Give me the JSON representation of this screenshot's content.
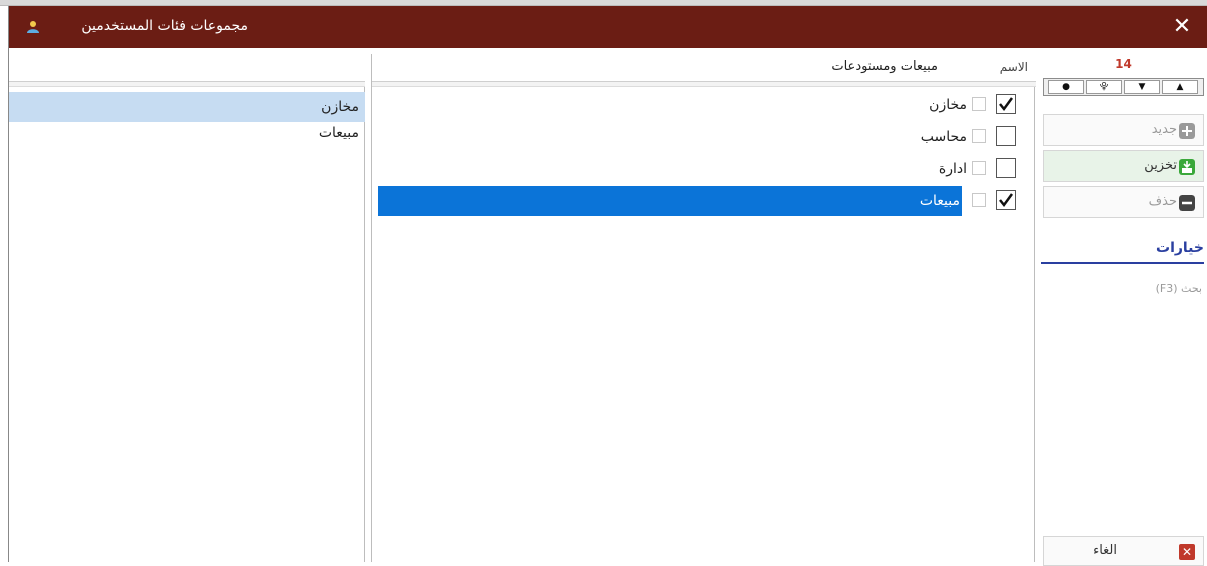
{
  "window": {
    "title": "مجموعات فئات المستخدمين",
    "close_glyph": "✕"
  },
  "left_list": {
    "items": [
      {
        "label": "مخازن",
        "selected": true
      },
      {
        "label": "مبيعات",
        "selected": false
      }
    ]
  },
  "grid": {
    "column_name_header": "الاسم",
    "value_header": "مبيعات ومستودعات",
    "rows": [
      {
        "name": "مخازن",
        "checked": true,
        "selected": false
      },
      {
        "name": "محاسب",
        "checked": false,
        "selected": false
      },
      {
        "name": "ادارة",
        "checked": false,
        "selected": false
      },
      {
        "name": "مبيعات",
        "checked": true,
        "selected": true
      }
    ]
  },
  "toolbar": {
    "record_count": "14",
    "nav": [
      "⯒",
      "▲",
      "▼",
      "⯓",
      "●"
    ],
    "new_label": "جديد",
    "save_label": "تخزين",
    "delete_label": "حذف",
    "options_title": "خيارات",
    "search_label": "بحث (F3)",
    "cancel_label": "الغاء"
  },
  "colors": {
    "titlebar": "#6b1d14",
    "selection": "#0b74d8",
    "left_selection": "#c6dcf2",
    "accent": "#2a3fa0",
    "count": "#c0392b"
  }
}
